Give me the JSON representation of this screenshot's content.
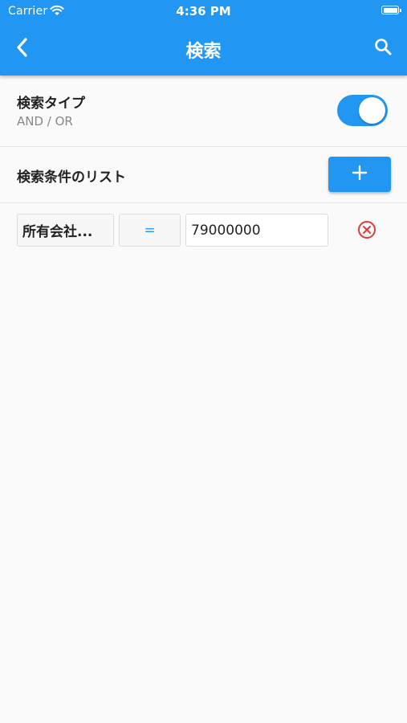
{
  "status_bar": {
    "carrier": "Carrier",
    "time": "4:36 PM"
  },
  "nav": {
    "title": "検索",
    "back_icon": "chevron-left-icon",
    "search_icon": "search-icon"
  },
  "search_type": {
    "title": "検索タイプ",
    "subtitle": "AND / OR",
    "toggle_on": true
  },
  "condition_list": {
    "title": "検索条件のリスト",
    "add_icon": "plus-icon"
  },
  "conditions": [
    {
      "field": "所有会社...",
      "operator": "=",
      "value": "79000000",
      "remove_icon": "cancel-circle-icon"
    }
  ],
  "colors": {
    "accent": "#2196f3",
    "remove": "#e53935",
    "background": "#fafafa"
  }
}
